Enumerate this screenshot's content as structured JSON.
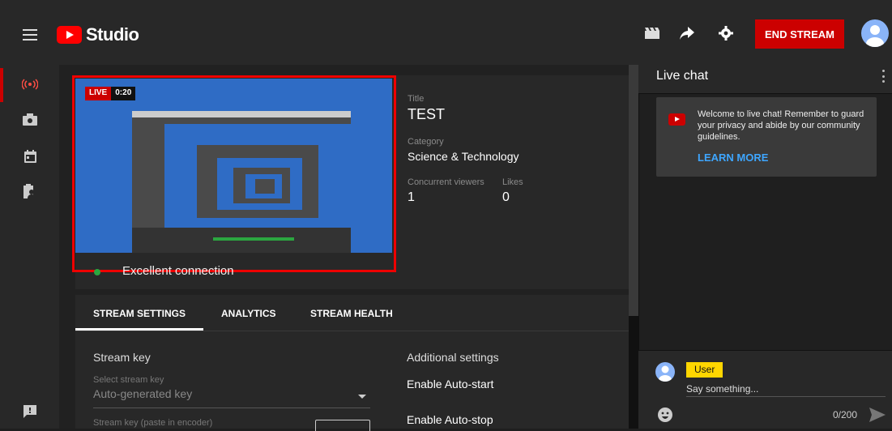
{
  "app": {
    "logo_text": "Studio"
  },
  "topbar": {
    "icons": [
      "menu-icon",
      "clapperboard-icon",
      "share-icon",
      "gear-icon",
      "account-avatar"
    ],
    "end_stream_label": "END STREAM",
    "colors": {
      "accent": "#cc0000",
      "brand": "#ff0000",
      "link": "#3ea6ff",
      "badge": "#ffd600"
    }
  },
  "sidebar": {
    "items": [
      {
        "icon": "live-broadcast-icon",
        "active": true
      },
      {
        "icon": "camera-icon",
        "active": false
      },
      {
        "icon": "calendar-icon",
        "active": false
      },
      {
        "icon": "clipboard-person-icon",
        "active": false
      },
      {
        "icon": "feedback-icon",
        "active": false
      }
    ]
  },
  "preview": {
    "live_label": "LIVE",
    "elapsed": "0:20",
    "connection_status": "Excellent connection"
  },
  "stream_info": {
    "title_label": "Title",
    "title_value": "TEST",
    "category_label": "Category",
    "category_value": "Science & Technology",
    "viewers_label": "Concurrent viewers",
    "viewers_value": "1",
    "likes_label": "Likes",
    "likes_value": "0"
  },
  "tabs": [
    {
      "label": "STREAM SETTINGS",
      "active": true
    },
    {
      "label": "ANALYTICS",
      "active": false
    },
    {
      "label": "STREAM HEALTH",
      "active": false
    }
  ],
  "settings": {
    "stream_key_heading": "Stream key",
    "select_key_label": "Select stream key",
    "select_key_value": "Auto-generated key",
    "paste_key_label": "Stream key (paste in encoder)",
    "additional_heading": "Additional settings",
    "auto_start_label": "Enable Auto-start",
    "auto_stop_label": "Enable Auto-stop"
  },
  "chat": {
    "title": "Live chat",
    "welcome_text": "Welcome to live chat! Remember to guard your privacy and abide by our community guidelines.",
    "learn_more": "LEARN MORE",
    "user_name": "User",
    "input_placeholder": "Say something...",
    "char_count": "0/200"
  }
}
